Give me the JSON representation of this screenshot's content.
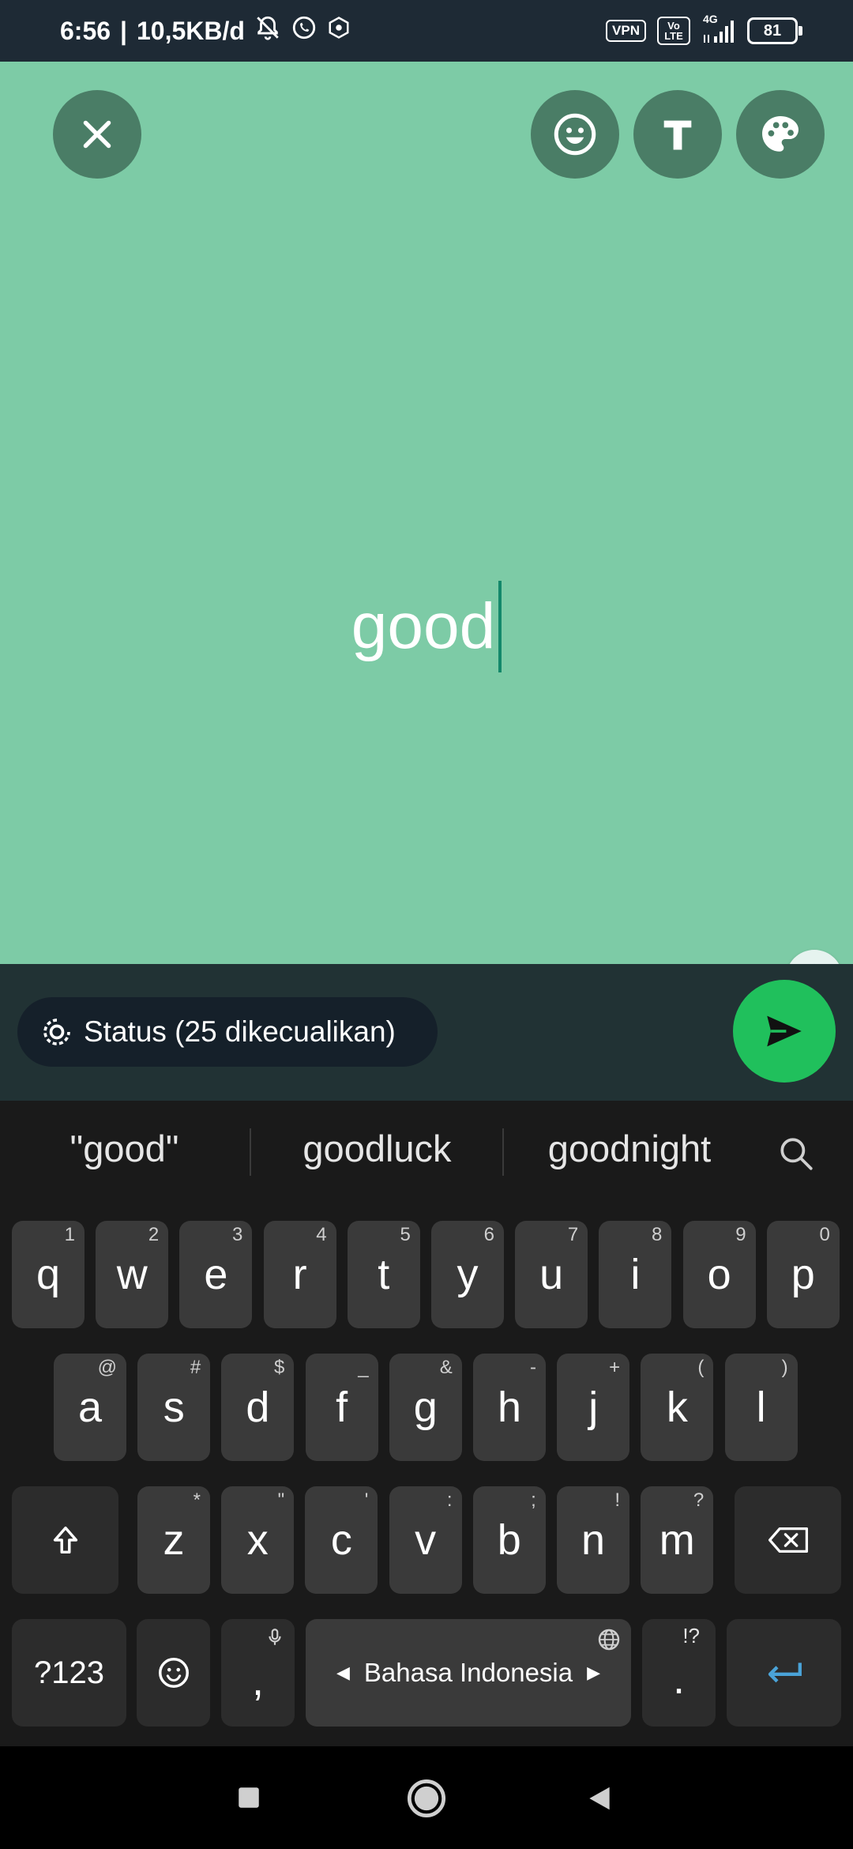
{
  "status_bar": {
    "time": "6:56",
    "network_speed": "10,5KB/d",
    "vpn_label": "VPN",
    "volte_label": "Vo LTE",
    "signal_label": "4G",
    "battery": "81"
  },
  "canvas": {
    "status_text": "good",
    "background_color": "#7dcba6"
  },
  "audience": {
    "label": "Status (25 dikecualikan)"
  },
  "suggestions": [
    "\"good\"",
    "goodluck",
    "goodnight"
  ],
  "keyboard": {
    "row1": [
      {
        "k": "q",
        "h": "1"
      },
      {
        "k": "w",
        "h": "2"
      },
      {
        "k": "e",
        "h": "3"
      },
      {
        "k": "r",
        "h": "4"
      },
      {
        "k": "t",
        "h": "5"
      },
      {
        "k": "y",
        "h": "6"
      },
      {
        "k": "u",
        "h": "7"
      },
      {
        "k": "i",
        "h": "8"
      },
      {
        "k": "o",
        "h": "9"
      },
      {
        "k": "p",
        "h": "0"
      }
    ],
    "row2": [
      {
        "k": "a",
        "h": "@"
      },
      {
        "k": "s",
        "h": "#"
      },
      {
        "k": "d",
        "h": "$"
      },
      {
        "k": "f",
        "h": "_"
      },
      {
        "k": "g",
        "h": "&"
      },
      {
        "k": "h",
        "h": "-"
      },
      {
        "k": "j",
        "h": "+"
      },
      {
        "k": "k",
        "h": "("
      },
      {
        "k": "l",
        "h": ")"
      }
    ],
    "row3": [
      {
        "k": "z",
        "h": "*"
      },
      {
        "k": "x",
        "h": "\""
      },
      {
        "k": "c",
        "h": "'"
      },
      {
        "k": "v",
        "h": ":"
      },
      {
        "k": "b",
        "h": ";"
      },
      {
        "k": "n",
        "h": "!"
      },
      {
        "k": "m",
        "h": "?"
      }
    ],
    "symbols_key": "?123",
    "comma_key": ",",
    "space_label": "Bahasa Indonesia",
    "period_key": ".",
    "period_hint": "!?"
  },
  "colors": {
    "send_button": "#20c05c",
    "cursor": "#13886a",
    "enter_key_arrow": "#4aa3d8"
  }
}
